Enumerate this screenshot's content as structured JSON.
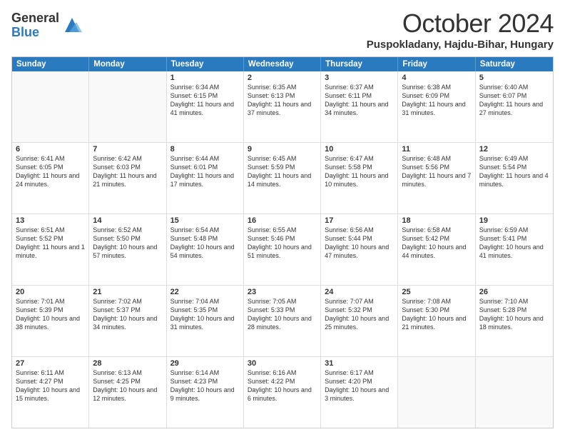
{
  "logo": {
    "general": "General",
    "blue": "Blue"
  },
  "header": {
    "month": "October 2024",
    "location": "Puspokladany, Hajdu-Bihar, Hungary"
  },
  "days": [
    "Sunday",
    "Monday",
    "Tuesday",
    "Wednesday",
    "Thursday",
    "Friday",
    "Saturday"
  ],
  "weeks": [
    [
      {
        "day": "",
        "info": ""
      },
      {
        "day": "",
        "info": ""
      },
      {
        "day": "1",
        "info": "Sunrise: 6:34 AM\nSunset: 6:15 PM\nDaylight: 11 hours and 41 minutes."
      },
      {
        "day": "2",
        "info": "Sunrise: 6:35 AM\nSunset: 6:13 PM\nDaylight: 11 hours and 37 minutes."
      },
      {
        "day": "3",
        "info": "Sunrise: 6:37 AM\nSunset: 6:11 PM\nDaylight: 11 hours and 34 minutes."
      },
      {
        "day": "4",
        "info": "Sunrise: 6:38 AM\nSunset: 6:09 PM\nDaylight: 11 hours and 31 minutes."
      },
      {
        "day": "5",
        "info": "Sunrise: 6:40 AM\nSunset: 6:07 PM\nDaylight: 11 hours and 27 minutes."
      }
    ],
    [
      {
        "day": "6",
        "info": "Sunrise: 6:41 AM\nSunset: 6:05 PM\nDaylight: 11 hours and 24 minutes."
      },
      {
        "day": "7",
        "info": "Sunrise: 6:42 AM\nSunset: 6:03 PM\nDaylight: 11 hours and 21 minutes."
      },
      {
        "day": "8",
        "info": "Sunrise: 6:44 AM\nSunset: 6:01 PM\nDaylight: 11 hours and 17 minutes."
      },
      {
        "day": "9",
        "info": "Sunrise: 6:45 AM\nSunset: 5:59 PM\nDaylight: 11 hours and 14 minutes."
      },
      {
        "day": "10",
        "info": "Sunrise: 6:47 AM\nSunset: 5:58 PM\nDaylight: 11 hours and 10 minutes."
      },
      {
        "day": "11",
        "info": "Sunrise: 6:48 AM\nSunset: 5:56 PM\nDaylight: 11 hours and 7 minutes."
      },
      {
        "day": "12",
        "info": "Sunrise: 6:49 AM\nSunset: 5:54 PM\nDaylight: 11 hours and 4 minutes."
      }
    ],
    [
      {
        "day": "13",
        "info": "Sunrise: 6:51 AM\nSunset: 5:52 PM\nDaylight: 11 hours and 1 minute."
      },
      {
        "day": "14",
        "info": "Sunrise: 6:52 AM\nSunset: 5:50 PM\nDaylight: 10 hours and 57 minutes."
      },
      {
        "day": "15",
        "info": "Sunrise: 6:54 AM\nSunset: 5:48 PM\nDaylight: 10 hours and 54 minutes."
      },
      {
        "day": "16",
        "info": "Sunrise: 6:55 AM\nSunset: 5:46 PM\nDaylight: 10 hours and 51 minutes."
      },
      {
        "day": "17",
        "info": "Sunrise: 6:56 AM\nSunset: 5:44 PM\nDaylight: 10 hours and 47 minutes."
      },
      {
        "day": "18",
        "info": "Sunrise: 6:58 AM\nSunset: 5:42 PM\nDaylight: 10 hours and 44 minutes."
      },
      {
        "day": "19",
        "info": "Sunrise: 6:59 AM\nSunset: 5:41 PM\nDaylight: 10 hours and 41 minutes."
      }
    ],
    [
      {
        "day": "20",
        "info": "Sunrise: 7:01 AM\nSunset: 5:39 PM\nDaylight: 10 hours and 38 minutes."
      },
      {
        "day": "21",
        "info": "Sunrise: 7:02 AM\nSunset: 5:37 PM\nDaylight: 10 hours and 34 minutes."
      },
      {
        "day": "22",
        "info": "Sunrise: 7:04 AM\nSunset: 5:35 PM\nDaylight: 10 hours and 31 minutes."
      },
      {
        "day": "23",
        "info": "Sunrise: 7:05 AM\nSunset: 5:33 PM\nDaylight: 10 hours and 28 minutes."
      },
      {
        "day": "24",
        "info": "Sunrise: 7:07 AM\nSunset: 5:32 PM\nDaylight: 10 hours and 25 minutes."
      },
      {
        "day": "25",
        "info": "Sunrise: 7:08 AM\nSunset: 5:30 PM\nDaylight: 10 hours and 21 minutes."
      },
      {
        "day": "26",
        "info": "Sunrise: 7:10 AM\nSunset: 5:28 PM\nDaylight: 10 hours and 18 minutes."
      }
    ],
    [
      {
        "day": "27",
        "info": "Sunrise: 6:11 AM\nSunset: 4:27 PM\nDaylight: 10 hours and 15 minutes."
      },
      {
        "day": "28",
        "info": "Sunrise: 6:13 AM\nSunset: 4:25 PM\nDaylight: 10 hours and 12 minutes."
      },
      {
        "day": "29",
        "info": "Sunrise: 6:14 AM\nSunset: 4:23 PM\nDaylight: 10 hours and 9 minutes."
      },
      {
        "day": "30",
        "info": "Sunrise: 6:16 AM\nSunset: 4:22 PM\nDaylight: 10 hours and 6 minutes."
      },
      {
        "day": "31",
        "info": "Sunrise: 6:17 AM\nSunset: 4:20 PM\nDaylight: 10 hours and 3 minutes."
      },
      {
        "day": "",
        "info": ""
      },
      {
        "day": "",
        "info": ""
      }
    ]
  ]
}
